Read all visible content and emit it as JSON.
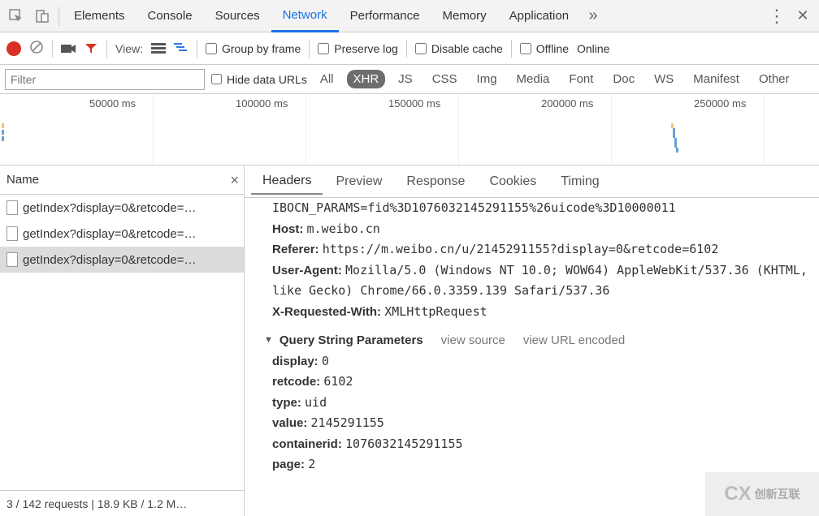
{
  "top_tabs": {
    "items": [
      "Elements",
      "Console",
      "Sources",
      "Network",
      "Performance",
      "Memory",
      "Application"
    ],
    "active_index": 3
  },
  "toolbar": {
    "view_label": "View:",
    "group_by_frame": "Group by frame",
    "preserve_log": "Preserve log",
    "disable_cache": "Disable cache",
    "offline": "Offline",
    "online": "Online"
  },
  "filter_bar": {
    "placeholder": "Filter",
    "hide_data_urls": "Hide data URLs",
    "types": [
      "All",
      "XHR",
      "JS",
      "CSS",
      "Img",
      "Media",
      "Font",
      "Doc",
      "WS",
      "Manifest",
      "Other"
    ],
    "active_type_index": 1
  },
  "timeline": {
    "ticks": [
      "50000 ms",
      "100000 ms",
      "150000 ms",
      "200000 ms",
      "250000 ms"
    ]
  },
  "requests": {
    "header": "Name",
    "items": [
      "getIndex?display=0&retcode=…",
      "getIndex?display=0&retcode=…",
      "getIndex?display=0&retcode=…"
    ],
    "selected_index": 2,
    "status": "3 / 142 requests  |  18.9 KB / 1.2 M…"
  },
  "detail_tabs": {
    "items": [
      "Headers",
      "Preview",
      "Response",
      "Cookies",
      "Timing"
    ],
    "active_index": 0
  },
  "headers": {
    "cookie_fragment": "IBOCN_PARAMS=fid%3D1076032145291155%26uicode%3D10000011",
    "host_label": "Host:",
    "host_value": "m.weibo.cn",
    "referer_label": "Referer:",
    "referer_value": "https://m.weibo.cn/u/2145291155?display=0&retcode=6102",
    "ua_label": "User-Agent:",
    "ua_value": "Mozilla/5.0 (Windows NT 10.0; WOW64) AppleWebKit/537.36 (KHTML, like Gecko) Chrome/66.0.3359.139 Safari/537.36",
    "xrw_label": "X-Requested-With:",
    "xrw_value": "XMLHttpRequest"
  },
  "query_section": {
    "title": "Query String Parameters",
    "view_source": "view source",
    "view_url_encoded": "view URL encoded",
    "params": [
      {
        "k": "display:",
        "v": "0"
      },
      {
        "k": "retcode:",
        "v": "6102"
      },
      {
        "k": "type:",
        "v": "uid"
      },
      {
        "k": "value:",
        "v": "2145291155"
      },
      {
        "k": "containerid:",
        "v": "1076032145291155"
      },
      {
        "k": "page:",
        "v": "2"
      }
    ]
  },
  "watermark": {
    "brand": "创新互联",
    "cx": "CX"
  }
}
